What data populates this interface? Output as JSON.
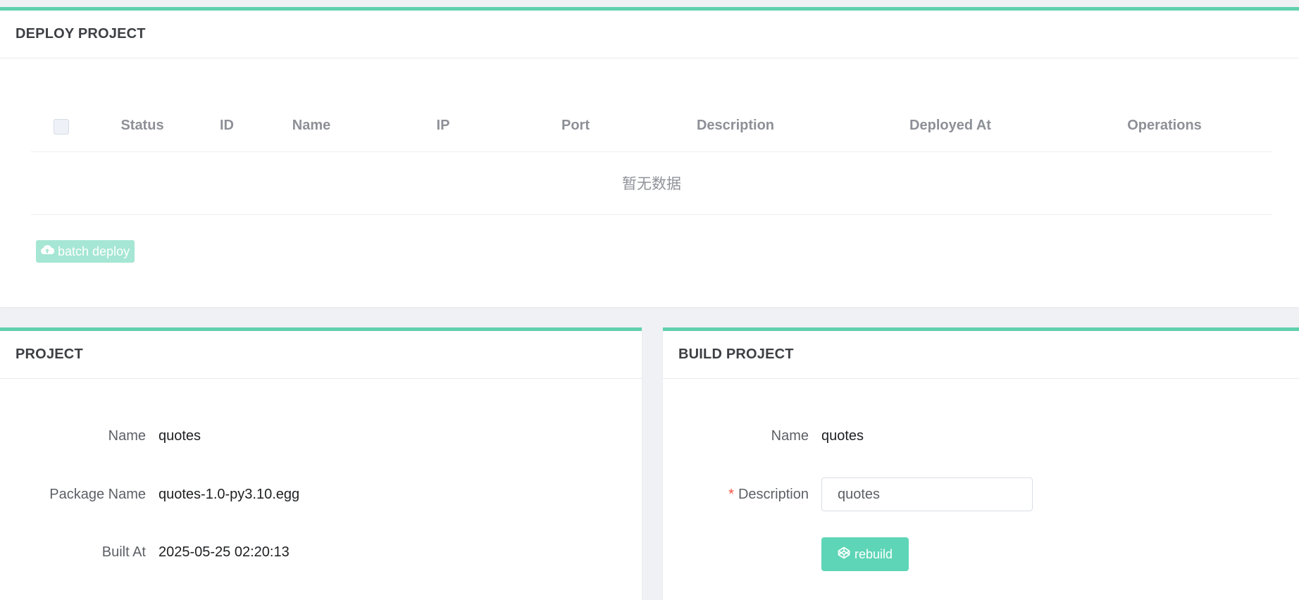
{
  "deploy": {
    "title": "DEPLOY PROJECT",
    "columns": [
      "Status",
      "ID",
      "Name",
      "IP",
      "Port",
      "Description",
      "Deployed At",
      "Operations"
    ],
    "empty_text": "暂无数据",
    "batch_deploy_label": "batch deploy"
  },
  "project": {
    "title": "PROJECT",
    "fields": [
      {
        "label": "Name",
        "value": "quotes"
      },
      {
        "label": "Package Name",
        "value": "quotes-1.0-py3.10.egg"
      },
      {
        "label": "Built At",
        "value": "2025-05-25 02:20:13"
      }
    ]
  },
  "build": {
    "title": "BUILD PROJECT",
    "name_label": "Name",
    "name_value": "quotes",
    "required_mark": "*",
    "description_label": "Description",
    "description_value": "quotes",
    "rebuild_label": "rebuild"
  },
  "icons": {
    "batch_deploy": "cloud-upload-icon",
    "rebuild": "codepen-icon"
  },
  "colors": {
    "accent": "#5fd0ad",
    "button_primary": "#5dd5b6",
    "button_disabled": "#a6e6d4",
    "required": "#f0503c"
  }
}
